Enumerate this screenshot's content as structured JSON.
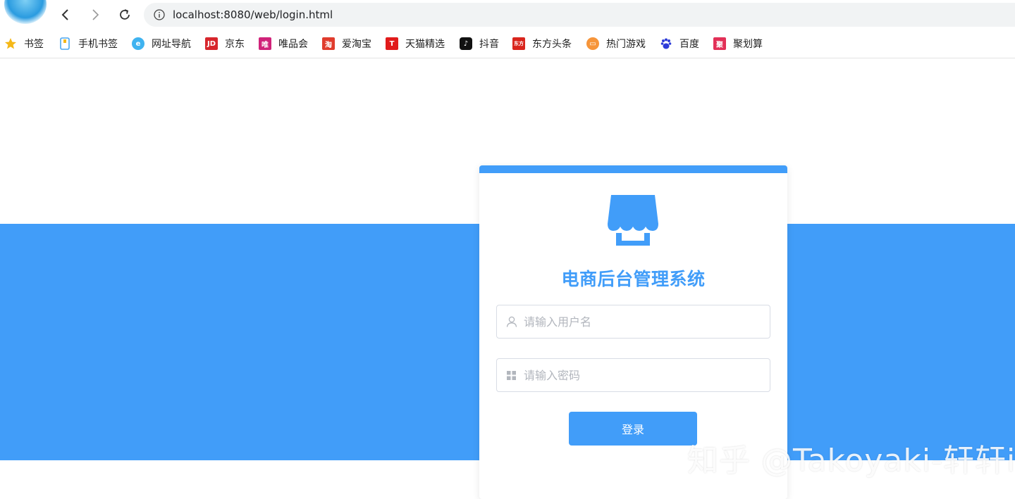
{
  "browser": {
    "url": "localhost:8080/web/login.html"
  },
  "bookmarks": [
    {
      "label": "书签",
      "icon": "star-icon",
      "color": "#f5b818"
    },
    {
      "label": "手机书签",
      "icon": "phone-bookmark-icon",
      "color": "#4aa6ef"
    },
    {
      "label": "网址导航",
      "icon": "e-browser-icon",
      "color": "#3fb3f0"
    },
    {
      "label": "京东",
      "icon": "jd-icon",
      "color": "#d7262c"
    },
    {
      "label": "唯品会",
      "icon": "vip-icon",
      "color": "#d0237a"
    },
    {
      "label": "爱淘宝",
      "icon": "taobao-icon",
      "color": "#e03c2d"
    },
    {
      "label": "天猫精选",
      "icon": "tmall-icon",
      "color": "#e11b1b"
    },
    {
      "label": "抖音",
      "icon": "douyin-icon",
      "color": "#111111"
    },
    {
      "label": "东方头条",
      "icon": "dongfang-icon",
      "color": "#d9251d"
    },
    {
      "label": "热门游戏",
      "icon": "game-icon",
      "color": "#f6953a"
    },
    {
      "label": "百度",
      "icon": "baidu-icon",
      "color": "#2d3bd8"
    },
    {
      "label": "聚划算",
      "icon": "juhuasuan-icon",
      "color": "#e23057"
    }
  ],
  "login": {
    "title": "电商后台管理系统",
    "username_placeholder": "请输入用户名",
    "password_placeholder": "请输入密码",
    "login_label": "登录"
  },
  "watermark": "知乎 @Takoyaki-轩轩i",
  "colors": {
    "accent": "#419df9"
  }
}
